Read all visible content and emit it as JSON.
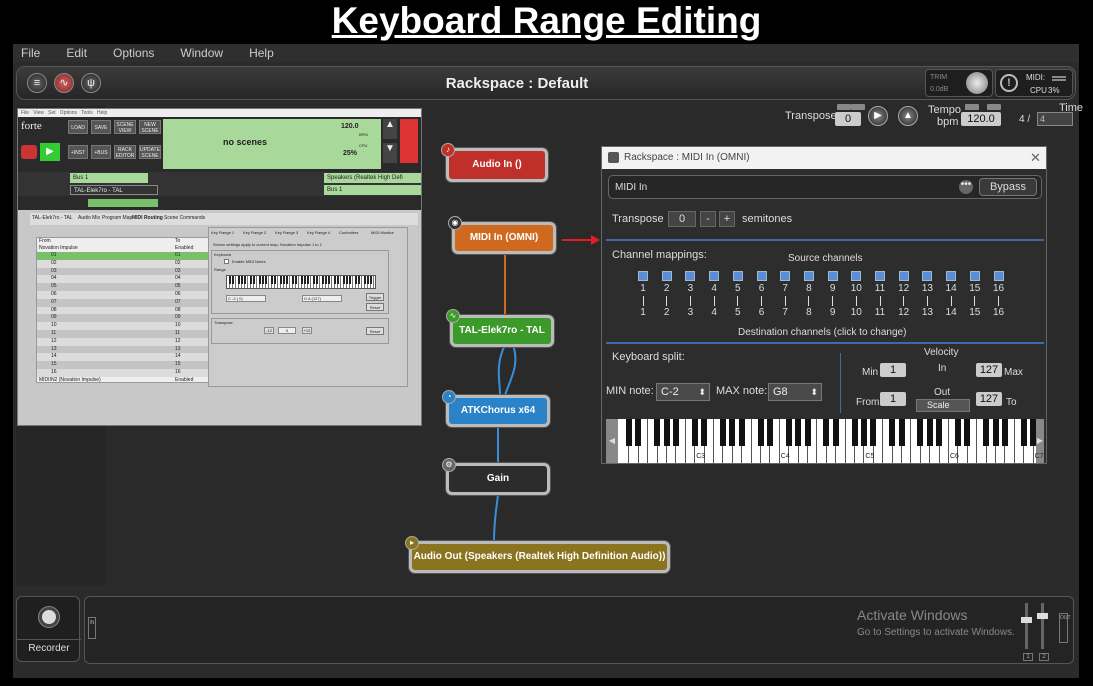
{
  "heading": "Keyboard Range Editing",
  "menu": [
    "File",
    "Edit",
    "Options",
    "Window",
    "Help"
  ],
  "toolbar": {
    "rackspace_title": "Rackspace : Default",
    "trim_label": "TRIM",
    "trim_value": "0.0dB",
    "midi_label": "MIDI:",
    "cpu_label": "CPU",
    "cpu_value": "3%"
  },
  "transport": {
    "transpose_label": "Transpose",
    "transpose_value": "0",
    "tempo_label": "Tempo",
    "bpm_label": "bpm",
    "tempo_value": "120.0",
    "time_label": "Time",
    "time_num": "4 /",
    "time_den": "4"
  },
  "nodes": {
    "audio_in": "Audio In ()",
    "midi_in": "MIDI In (OMNI)",
    "tal": "TAL-Elek7ro - TAL",
    "atk": "ATKChorus x64",
    "gain": "Gain",
    "audio_out": "Audio Out (Speakers (Realtek High Definition Audio))"
  },
  "forte": {
    "logo": "forte",
    "buttons": [
      "LOAD",
      "SAVE",
      "SCENE VIEW",
      "NEW SCENE",
      "+INST",
      "+BUS",
      "RACK EDITOR",
      "UPDATE SCENE"
    ],
    "scene_text": "no scenes",
    "bpm_value": "120.0",
    "bpm_label": "BPM",
    "cpu_label": "CPU",
    "cpu_value": "25%",
    "bus_row1": "Bus 1",
    "bus_row1_right": "Speakers (Realtek High Defi",
    "inst_row": "TAL-Elek7ro - TAL",
    "bus_row2_right": "Bus 1",
    "tabs": [
      "TAL-Elek7ro - TAL",
      "Audio Mix",
      "Program Map",
      "MIDI Routing",
      "Scene Commands"
    ],
    "list_header_from": "From",
    "list_header_to": "To",
    "list_parent": "Novation Impulse",
    "list_parent_to": "Enabled",
    "list_rows": [
      "01",
      "02",
      "03",
      "04",
      "05",
      "06",
      "07",
      "08",
      "09",
      "10",
      "11",
      "12",
      "13",
      "14",
      "15",
      "16"
    ],
    "list_footer": "MIDIIN2 (Novation Impulse)",
    "list_footer_to": "Enabled",
    "right_tabs": [
      "Key Range 1",
      "Key Range 2",
      "Key Range 3",
      "Key Range 4",
      "Controllers",
      "MIDI Monitor"
    ],
    "right_note": "Shown settings apply to current map: Novation Impulse 1 to 1",
    "keyboard_group": "Keyboard",
    "enable_midi": "Enable MIDI Notes",
    "range_label": "Range",
    "range_low": "C -2 ( 0)",
    "range_high": "G 8 (127)",
    "trigger_btn": "Trigger",
    "reset_btn": "Reset",
    "transpose_group": "Transpose",
    "transpose_val": "0",
    "reset2_btn": "Reset"
  },
  "midi_window": {
    "title": "Rackspace : MIDI In (OMNI)",
    "name": "MIDI In",
    "bypass": "Bypass",
    "transpose_label": "Transpose",
    "transpose_value": "0",
    "minus": "-",
    "plus": "+",
    "semitones": "semitones",
    "channel_mappings": "Channel mappings:",
    "source_channels": "Source channels",
    "channels": [
      "1",
      "2",
      "3",
      "4",
      "5",
      "6",
      "7",
      "8",
      "9",
      "10",
      "11",
      "12",
      "13",
      "14",
      "15",
      "16"
    ],
    "destination_label": "Destination channels (click to change)",
    "keyboard_split": "Keyboard split:",
    "min_note_label": "MIN note:",
    "min_note": "C-2",
    "max_note_label": "MAX note:",
    "max_note": "G8",
    "velocity_label": "Velocity",
    "in_label": "In",
    "out_label": "Out",
    "min_label": "Min",
    "max_label": "Max",
    "from_label": "From",
    "to_label": "To",
    "vel_min": "1",
    "vel_max": "127",
    "vel_from": "1",
    "vel_to": "127",
    "scale": "Scale",
    "octave_labels": [
      "C3",
      "C4",
      "C5",
      "C6",
      "C7"
    ]
  },
  "bottom": {
    "recorder": "Recorder",
    "in_label": "IN",
    "out_label": "OUT",
    "activate_title": "Activate Windows",
    "activate_sub": "Go to Settings to activate Windows.",
    "ch1": "1",
    "ch2": "2"
  }
}
